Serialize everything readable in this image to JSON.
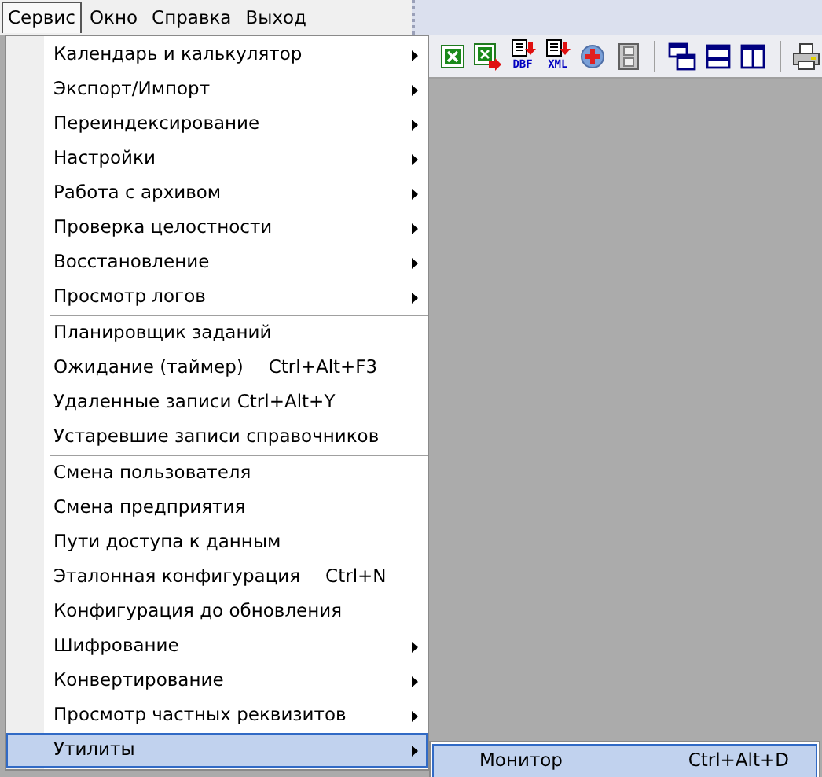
{
  "menu_bar": [
    {
      "label": "Сервис",
      "selected": true
    },
    {
      "label": "Окно",
      "selected": false
    },
    {
      "label": "Справка",
      "selected": false
    },
    {
      "label": "Выход",
      "selected": false
    }
  ],
  "toolbar": [
    {
      "kind": "excel"
    },
    {
      "kind": "excel-export"
    },
    {
      "kind": "file",
      "label": "DBF"
    },
    {
      "kind": "file",
      "label": "XML"
    },
    {
      "kind": "add"
    },
    {
      "kind": "film"
    },
    {
      "kind": "separator"
    },
    {
      "kind": "cascade"
    },
    {
      "kind": "tile-h"
    },
    {
      "kind": "tile-v"
    },
    {
      "kind": "separator"
    },
    {
      "kind": "printer"
    }
  ],
  "menu": [
    {
      "kind": "item",
      "label": "Календарь и калькулятор",
      "submenu": true,
      "selected": false
    },
    {
      "kind": "item",
      "label": "Экспорт/Импорт",
      "submenu": true,
      "selected": false
    },
    {
      "kind": "item",
      "label": "Переиндексирование",
      "submenu": true,
      "selected": false
    },
    {
      "kind": "item",
      "label": "Настройки",
      "submenu": true,
      "selected": false
    },
    {
      "kind": "item",
      "label": "Работа с архивом",
      "submenu": true,
      "selected": false
    },
    {
      "kind": "item",
      "label": "Проверка целостности",
      "submenu": true,
      "selected": false
    },
    {
      "kind": "item",
      "label": "Восстановление",
      "submenu": true,
      "selected": false
    },
    {
      "kind": "item",
      "label": "Просмотр логов",
      "submenu": true,
      "selected": false
    },
    {
      "kind": "separator"
    },
    {
      "kind": "item",
      "label": "Планировщик заданий",
      "submenu": false,
      "selected": false
    },
    {
      "kind": "item",
      "label": "Ожидание (таймер)",
      "shortcut": "Ctrl+Alt+F3",
      "submenu": false,
      "selected": false
    },
    {
      "kind": "item",
      "label": "Удаленные записи Ctrl+Alt+Y",
      "submenu": false,
      "selected": false
    },
    {
      "kind": "item",
      "label": "Устаревшие записи справочников",
      "submenu": false,
      "selected": false
    },
    {
      "kind": "separator"
    },
    {
      "kind": "item",
      "label": "Смена пользователя",
      "submenu": false,
      "selected": false
    },
    {
      "kind": "item",
      "label": "Смена предприятия",
      "submenu": false,
      "selected": false
    },
    {
      "kind": "item",
      "label": "Пути доступа к данным",
      "submenu": false,
      "selected": false
    },
    {
      "kind": "item",
      "label": "Эталонная конфигурация",
      "shortcut": "Ctrl+N",
      "submenu": false,
      "selected": false
    },
    {
      "kind": "item",
      "label": "Конфигурация до обновления",
      "submenu": false,
      "selected": false
    },
    {
      "kind": "item",
      "label": "Шифрование",
      "submenu": true,
      "selected": false
    },
    {
      "kind": "item",
      "label": "Конвертирование",
      "submenu": true,
      "selected": false
    },
    {
      "kind": "item",
      "label": "Просмотр частных реквизитов",
      "submenu": true,
      "selected": false
    },
    {
      "kind": "item",
      "label": "Утилиты",
      "submenu": true,
      "selected": true
    }
  ],
  "submenu": [
    {
      "label": "Монитор",
      "shortcut": "Ctrl+Alt+D",
      "selected": true
    }
  ]
}
